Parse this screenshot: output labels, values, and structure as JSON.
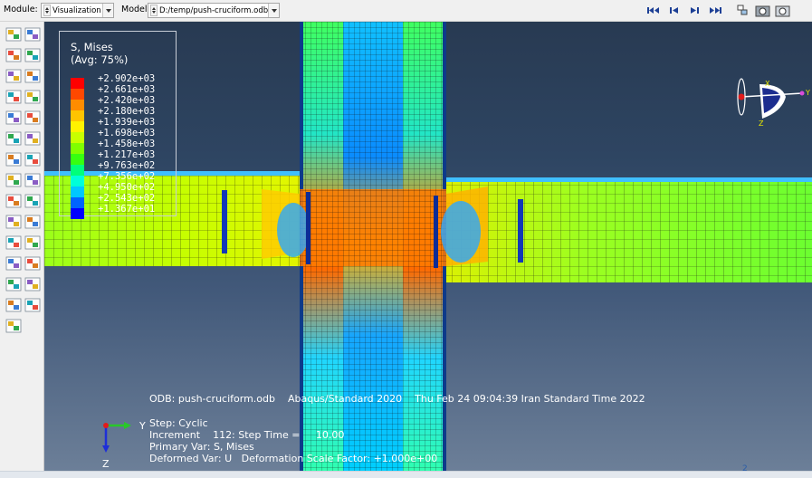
{
  "context_bar": {
    "module_label": "Module:",
    "module_value": "Visualization",
    "model_label": "Model:",
    "model_value": "D:/temp/push-cruciform.odb"
  },
  "animation_controls": [
    "first-frame",
    "previous-frame",
    "next-frame",
    "last-frame"
  ],
  "view_controls": [
    "query-icon",
    "camera-icon",
    "camera-icon-2"
  ],
  "toolbox": {
    "tools": [
      "plot-undeformed-icon",
      "plot-deformed-icon",
      "plot-contours-icon",
      "plot-contours-deformed-icon",
      "plot-symbols-icon",
      "plot-symbols-options-icon",
      "plot-material-orientation-icon",
      "plot-material-options-icon",
      "allow-multiple-plot-states-icon",
      "superimpose-options-icon",
      "contour-options-icon",
      "common-options-icon",
      "animate-time-history-icon",
      "animate-options-icon",
      "view-cut-icon",
      "view-cut-manager-icon",
      "xy-data-icon",
      "xy-data-manager-icon",
      "path-icon",
      "path-manager-icon",
      "display-group-icon",
      "display-group-manager-icon",
      "query-probe-icon",
      "query-options-icon",
      "stream-icon",
      "stream-manager-icon",
      "report-icon",
      "report-options-icon",
      "sketch-tool-icon"
    ]
  },
  "legend": {
    "title": "S, Mises",
    "subtitle": "(Avg: 75%)",
    "values": [
      "+2.902e+03",
      "+2.661e+03",
      "+2.420e+03",
      "+2.180e+03",
      "+1.939e+03",
      "+1.698e+03",
      "+1.458e+03",
      "+1.217e+03",
      "+9.763e+02",
      "+7.356e+02",
      "+4.950e+02",
      "+2.543e+02",
      "+1.367e+01"
    ],
    "colors": [
      "#ff0000",
      "#ff4800",
      "#ff8c00",
      "#ffc400",
      "#fff200",
      "#c8ff00",
      "#80ff00",
      "#36ff10",
      "#00ff7a",
      "#00ffd8",
      "#00c8ff",
      "#0064ff",
      "#0000ff"
    ]
  },
  "info": {
    "odb_line": "ODB: push-cruciform.odb    Abaqus/Standard 2020    Thu Feb 24 09:04:39 Iran Standard Time 2022",
    "step_line": "Step: Cyclic",
    "increment_line": "Increment    112: Step Time =     10.00",
    "primary_var_line": "Primary Var: S, Mises",
    "deformed_var_line": "Deformed Var: U   Deformation Scale Factor: +1.000e+00"
  },
  "triad": {
    "small_y": "Y",
    "small_z": "Z",
    "main_x": "X",
    "main_y": "Y",
    "main_z": "Z"
  },
  "status_digit": "2"
}
